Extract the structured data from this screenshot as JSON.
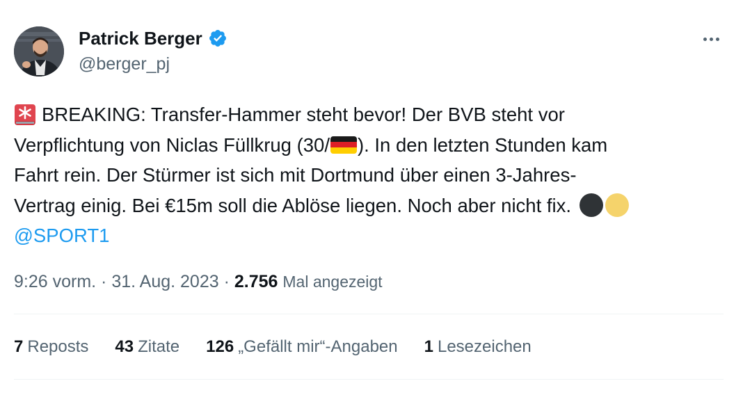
{
  "author": {
    "display_name": "Patrick Berger",
    "handle": "@berger_pj",
    "verified_color": "#1d9bf0",
    "avatar_icon": "profile-photo"
  },
  "menu": {
    "icon": "more-horizontal-icon"
  },
  "tweet": {
    "line1_text": "BREAKING: Transfer-Hammer steht bevor! Der BVB steht vor",
    "line2_before_flag": "Verpflichtung von Niclas Füllkrug (30/",
    "line2_after_flag": "). In den letzten Stunden kam",
    "line3": "Fahrt rein. Der Stürmer ist sich mit Dortmund über einen 3-Jahres-",
    "line4": "Vertrag einig. Bei €15m soll die Ablöse liegen. Noch aber nicht fix.",
    "mention": "@SPORT1",
    "emoji": [
      "rotating-light",
      "flag-germany",
      "black-circle",
      "yellow-circle"
    ]
  },
  "meta": {
    "time": "9:26 vorm.",
    "separator": " · ",
    "date": "31. Aug. 2023",
    "views_count": "2.756",
    "views_label": "Mal angezeigt"
  },
  "stats": {
    "reposts_count": "7",
    "reposts_label": "Reposts",
    "quotes_count": "43",
    "quotes_label": "Zitate",
    "likes_count": "126",
    "likes_label": "„Gefällt mir“-Angaben",
    "bookmarks_count": "1",
    "bookmarks_label": "Lesezeichen"
  },
  "colors": {
    "text": "#0f1419",
    "secondary": "#536471",
    "link": "#1d9bf0",
    "divider": "#eff3f4"
  }
}
